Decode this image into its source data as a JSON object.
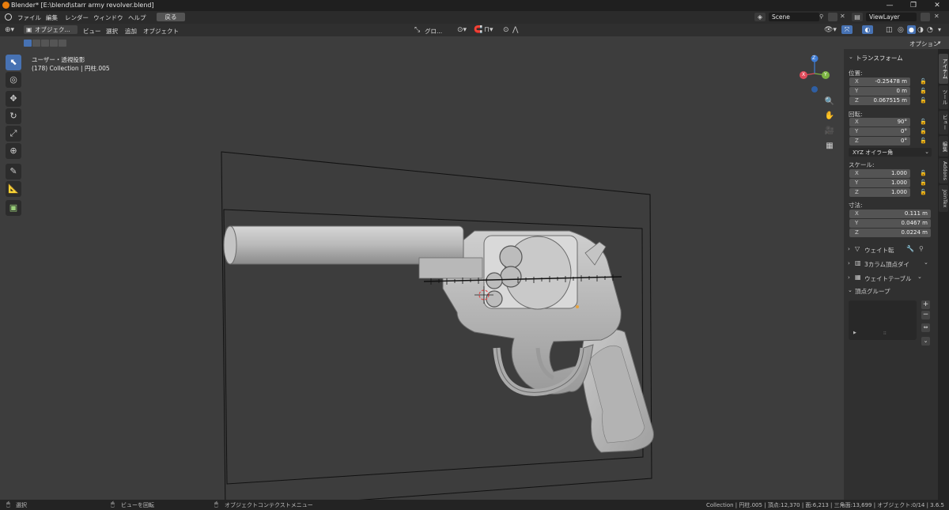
{
  "window": {
    "title": "Blender* [E:\\blend\\starr army revolver.blend]",
    "minimize": "—",
    "maximize": "❐",
    "close": "✕"
  },
  "menubar": {
    "items": [
      "ファイル",
      "編集",
      "レンダー",
      "ウィンドウ",
      "ヘルプ"
    ],
    "back_label": "戻る",
    "scene": "Scene",
    "view_layer": "ViewLayer"
  },
  "header": {
    "mode": "オブジェク...",
    "menus": [
      "ビュー",
      "選択",
      "追加",
      "オブジェクト"
    ],
    "orientation": "グロ...",
    "options_label": "オプション"
  },
  "viewport": {
    "view_name": "ユーザー・透視投影",
    "view_info": "(178) Collection | 円柱.005",
    "gizmo": {
      "x": "X",
      "y": "Y",
      "z": "Z"
    }
  },
  "panel": {
    "transform_title": "トランスフォーム",
    "location_label": "位置:",
    "location": [
      {
        "axis": "X",
        "value": "-0.25478 m"
      },
      {
        "axis": "Y",
        "value": "0 m"
      },
      {
        "axis": "Z",
        "value": "0.067515 m"
      }
    ],
    "rotation_label": "回転:",
    "rotation": [
      {
        "axis": "X",
        "value": "90°"
      },
      {
        "axis": "Y",
        "value": "0°"
      },
      {
        "axis": "Z",
        "value": "0°"
      }
    ],
    "rotation_mode": "XYZ オイラー角",
    "scale_label": "スケール:",
    "scale": [
      {
        "axis": "X",
        "value": "1.000"
      },
      {
        "axis": "Y",
        "value": "1.000"
      },
      {
        "axis": "Z",
        "value": "1.000"
      }
    ],
    "dimensions_label": "寸法:",
    "dimensions": [
      {
        "axis": "X",
        "value": "0.111 m"
      },
      {
        "axis": "Y",
        "value": "0.0467 m"
      },
      {
        "axis": "Z",
        "value": "0.0224 m"
      }
    ],
    "sections": [
      "ウェイト転",
      "3カラム頂点ダイ",
      "ウェイトテーブル"
    ],
    "vertex_groups": "頂点グループ"
  },
  "tabs": [
    "アイテム",
    "ツール",
    "ビュー",
    "編集",
    "Addons",
    "JoinTex"
  ],
  "statusbar": {
    "select": "選択",
    "rotate_view": "ビューを回転",
    "context_menu": "オブジェクトコンテクストメニュー",
    "stats": "Collection | 円柱.005 | 頂点:12,370 | 面:6,213 | 三角面:13,699 | オブジェクト:0/14 | 3.6.5"
  },
  "colors": {
    "accent": "#4772b3",
    "gizmo_x": "#e04b5a",
    "gizmo_y": "#7cb342",
    "gizmo_z": "#3f7dd6"
  }
}
